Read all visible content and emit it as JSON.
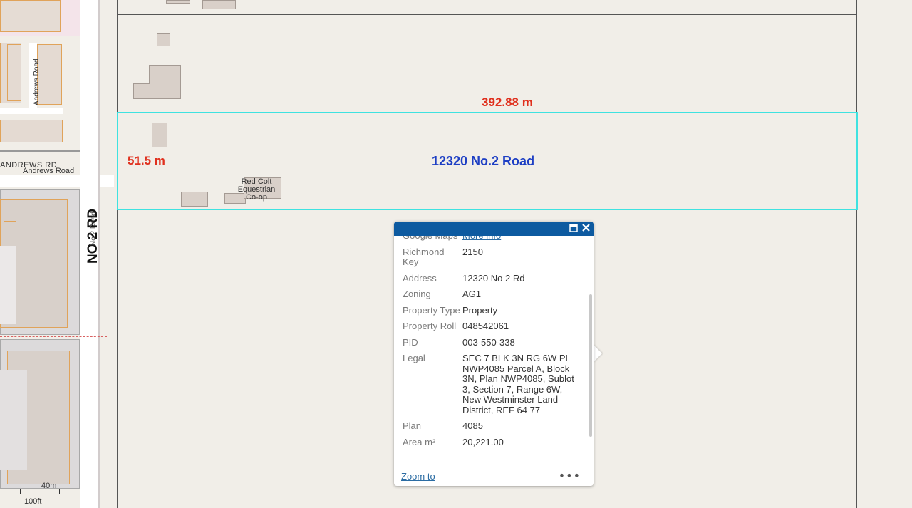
{
  "map": {
    "parcel_width_label": "392.88 m",
    "parcel_depth_label": "51.5 m",
    "parcel_address_label": "12320 No.2 Road",
    "road_labels": {
      "andrews_road_vertical": "Andrews Road",
      "andrews_rd_caps": "ANDREWS RD",
      "andrews_road_small": "Andrews Road",
      "no2_rd_caps": "NO 2 RD",
      "no2_road_small": "No 2 Road"
    },
    "poi_label": "Red Colt Equestrian Co-op",
    "scale_bar": {
      "metric": "40m",
      "imperial": "100ft"
    },
    "colors": {
      "highlight": "#3fe2e0",
      "measure": "#e0301e",
      "address": "#1e3fc4",
      "popup_header": "#0d5aa0"
    }
  },
  "popup": {
    "header_icons": {
      "maximize": "maximize-icon",
      "close": "close-icon"
    },
    "rows": [
      {
        "key": "Google Maps",
        "value": "More info",
        "link": true
      },
      {
        "key": "Richmond Key",
        "value": "2150"
      },
      {
        "key": "Address",
        "value": "12320 No 2 Rd"
      },
      {
        "key": "Zoning",
        "value": "AG1"
      },
      {
        "key": "Property Type",
        "value": "Property"
      },
      {
        "key": "Property Roll",
        "value": "048542061"
      },
      {
        "key": "PID",
        "value": "003-550-338"
      },
      {
        "key": "Legal",
        "value": "SEC 7 BLK 3N RG 6W PL NWP4085 Parcel A, Block 3N, Plan NWP4085, Sublot 3, Section 7, Range 6W, New Westminster Land District, REF 64 77"
      },
      {
        "key": "Plan",
        "value": "4085"
      },
      {
        "key": "Area m²",
        "value": "20,221.00"
      }
    ],
    "footer": {
      "zoom_label": "Zoom to",
      "more_icon": "more-icon"
    }
  }
}
